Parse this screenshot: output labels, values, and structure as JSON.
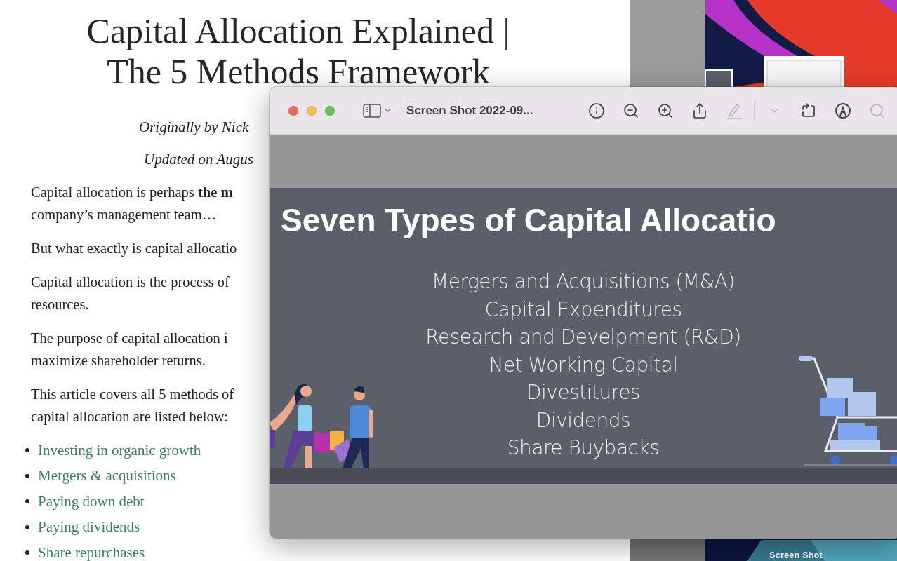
{
  "article": {
    "title_lines": [
      "Capital Allocation Explained |",
      "The 5 Methods Framework"
    ],
    "byline": "Originally by Nick",
    "updated": "Updated on Augus",
    "paragraphs": [
      {
        "lines": [
          "Capital allocation is perhaps **the m**",
          "company’s management team…"
        ]
      },
      {
        "lines": [
          "But what exactly is capital allocatio"
        ]
      },
      {
        "lines": [
          "Capital allocation is the process of",
          "resources."
        ]
      },
      {
        "lines": [
          "The purpose of capital allocation i",
          "maximize shareholder returns."
        ]
      },
      {
        "lines": [
          "This article covers all 5 methods of",
          "capital allocation are listed below:"
        ]
      }
    ],
    "links": [
      "Investing in organic growth",
      "Mergers & acquisitions",
      "Paying down debt",
      "Paying dividends",
      "Share repurchases"
    ]
  },
  "preview": {
    "title": "Screen Shot 2022-09...",
    "toolbar": [
      {
        "kind": "info",
        "disabled": false
      },
      {
        "kind": "zoom-out",
        "disabled": false
      },
      {
        "kind": "zoom-in",
        "disabled": false
      },
      {
        "kind": "share",
        "disabled": false
      },
      {
        "kind": "highlight",
        "disabled": true
      },
      {
        "kind": "menu",
        "disabled": true
      },
      {
        "kind": "rotate",
        "disabled": false
      },
      {
        "kind": "markup",
        "disabled": false
      },
      {
        "kind": "search",
        "disabled": true
      }
    ],
    "slide": {
      "title": "Seven Types of Capital Allocatio",
      "items": [
        "Mergers and Acquisitions (M&A)",
        "Capital Expenditures",
        "Research and Develpment (R&D)",
        "Net Working Capital",
        "Divestitures",
        "Dividends",
        "Share Buybacks"
      ]
    }
  },
  "desktop": {
    "file_label": "Screen Shot"
  }
}
